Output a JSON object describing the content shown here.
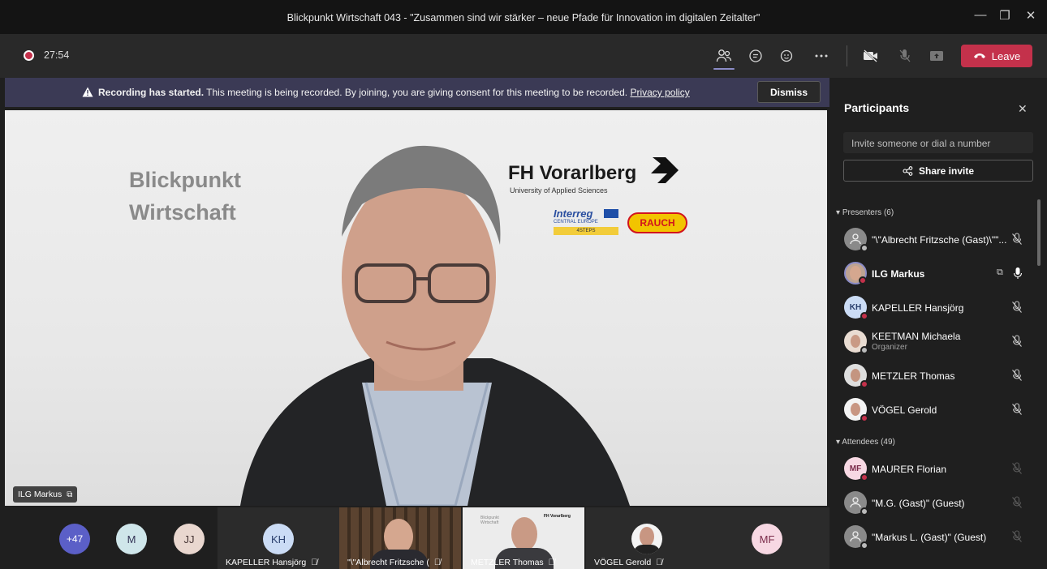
{
  "window": {
    "title": "Blickpunkt Wirtschaft 043 - \"Zusammen sind wir stärker – neue Pfade für Innovation im digitalen Zeitalter\"",
    "minimize": "—",
    "maximize": "❐",
    "close": "✕"
  },
  "toolbar": {
    "timer": "27:54",
    "leave_label": "Leave"
  },
  "banner": {
    "bold": "Recording has started.",
    "text": " This meeting is being recorded. By joining, you are giving consent for this meeting to be recorded. ",
    "link": "Privacy policy",
    "dismiss_label": "Dismiss"
  },
  "stage": {
    "slide_title_line1": "Blickpunkt",
    "slide_title_line2": "Wirtschaft",
    "logo_name": "FH Vorarlberg",
    "logo_sub": "University of Applied Sciences",
    "interreg_text": "Interreg",
    "interreg_sub": "CENTRAL EUROPE",
    "interreg_badge": "4STEPS",
    "rauch_text": "RAUCH",
    "speaker_name": "ILG Markus"
  },
  "gallery": {
    "more_count": "+47",
    "avatar_m": "M",
    "avatar_jj": "JJ",
    "tiles": [
      {
        "initials": "KH",
        "label": "KAPELLER Hansjörg"
      },
      {
        "label": "\"\\\"Albrecht Fritzsche ("
      },
      {
        "label": "METZLER Thomas",
        "slide_line1": "Blickpunkt",
        "slide_line2": "Wirtschaft",
        "slide_logo": "FH Vorarlberg"
      },
      {
        "label": "VÖGEL Gerold"
      },
      {
        "initials": "MF"
      }
    ]
  },
  "panel": {
    "title": "Participants",
    "invite_placeholder": "Invite someone or dial a number",
    "share_label": "Share invite",
    "presenters_header": "Presenters (6)",
    "attendees_header": "Attendees (49)",
    "presenters": [
      {
        "name": "\"\\\"Albrecht Fritzsche (Gast)\\\"\"...",
        "role": ""
      },
      {
        "name": "ILG Markus",
        "role": ""
      },
      {
        "name": "KAPELLER Hansjörg",
        "initials": "KH",
        "role": ""
      },
      {
        "name": "KEETMAN Michaela",
        "role": "Organizer"
      },
      {
        "name": "METZLER Thomas",
        "role": ""
      },
      {
        "name": "VÖGEL Gerold",
        "role": ""
      }
    ],
    "attendees": [
      {
        "name": "MAURER Florian",
        "initials": "MF"
      },
      {
        "name": "\"M.G. (Gast)\" (Guest)"
      },
      {
        "name": "\"Markus L. (Gast)\" (Guest)"
      }
    ]
  },
  "colors": {
    "accent": "#8b8cc7",
    "leave": "#c4314b",
    "banner": "#3b3a55",
    "panel": "#1f1f1f"
  }
}
